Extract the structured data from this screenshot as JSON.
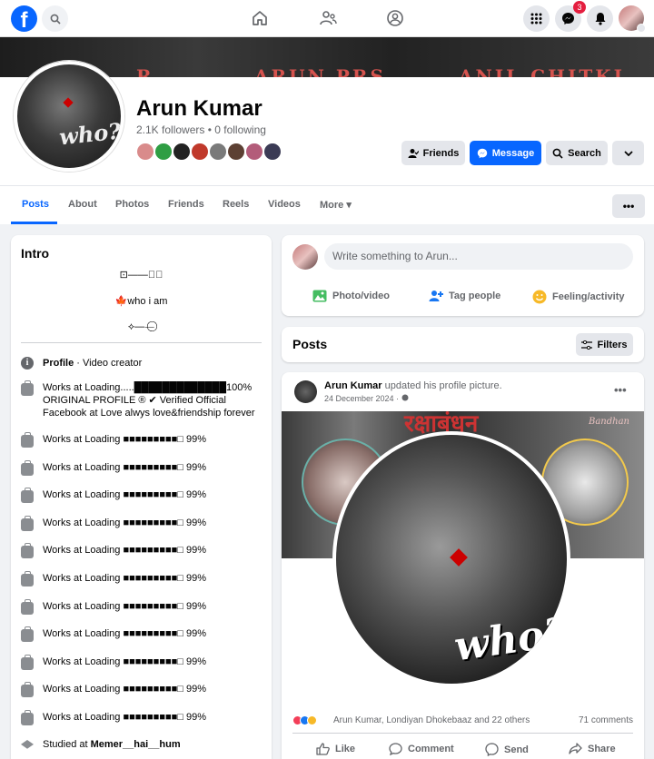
{
  "nav": {
    "logo_letter": "f",
    "messenger_badge": "3"
  },
  "cover": {
    "texts": [
      "R",
      "ARUN PRS",
      "ANIL CHITKI"
    ]
  },
  "profile": {
    "name": "Arun Kumar",
    "stats": "2.1K followers • 0 following",
    "avatar_caption": "who?",
    "buttons": {
      "friends": "Friends",
      "message": "Message",
      "search": "Search"
    },
    "friend_avatar_colors": [
      "#d98b8b",
      "#2f9e44",
      "#222222",
      "#c0392b",
      "#7a7a7a",
      "#5c4033",
      "#b35c7a",
      "#3b3b55"
    ]
  },
  "tabs": [
    {
      "label": "Posts",
      "active": true
    },
    {
      "label": "About"
    },
    {
      "label": "Photos"
    },
    {
      "label": "Friends"
    },
    {
      "label": "Reels"
    },
    {
      "label": "Videos"
    },
    {
      "label": "More ▾"
    }
  ],
  "intro": {
    "title": "Intro",
    "bio": [
      "⊡——⃝⟡",
      "🍁who i am",
      "⟡——⃝"
    ],
    "profile_label": "Profile",
    "profile_value": " · Video creator",
    "work_first": "Works at Loading.....█████████████100% ORIGINAL PROFILE ® ✔ Verified Official Facebook at Love alwys love&friendship forever",
    "work_items": [
      "Works at Loading ■■■■■■■■■□ 99%",
      "Works at Loading ■■■■■■■■■□ 99%",
      "Works at Loading ■■■■■■■■■□ 99%",
      "Works at Loading ■■■■■■■■■□ 99%",
      "Works at Loading ■■■■■■■■■□ 99%",
      "Works at Loading ■■■■■■■■■□ 99%",
      "Works at Loading ■■■■■■■■■□ 99%",
      "Works at Loading ■■■■■■■■■□ 99%",
      "Works at Loading ■■■■■■■■■□ 99%",
      "Works at Loading ■■■■■■■■■□ 99%",
      "Works at Loading ■■■■■■■■■□ 99%"
    ],
    "studied_prefix": "Studied at ",
    "studied_value": "Memer__hai__hum"
  },
  "composer": {
    "placeholder": "Write something to Arun...",
    "photo_video": "Photo/video",
    "tag_people": "Tag people",
    "feeling": "Feeling/activity"
  },
  "posts_bar": {
    "label": "Posts",
    "filters": "Filters"
  },
  "post": {
    "author": "Arun Kumar",
    "action": " updated his profile picture.",
    "date": "24 December 2024 · ",
    "image_title": "रक्षाबंधन",
    "image_sub": "Bandhan",
    "image_caption": "who?",
    "reactions_text": "Arun Kumar, Londiyan Dhokebaaz and 22 others",
    "comments": "71 comments",
    "like": "Like",
    "comment": "Comment",
    "send": "Send",
    "share": "Share"
  },
  "colors": {
    "brand": "#0866ff",
    "background": "#f0f2f5",
    "badge": "#e41e3f"
  }
}
